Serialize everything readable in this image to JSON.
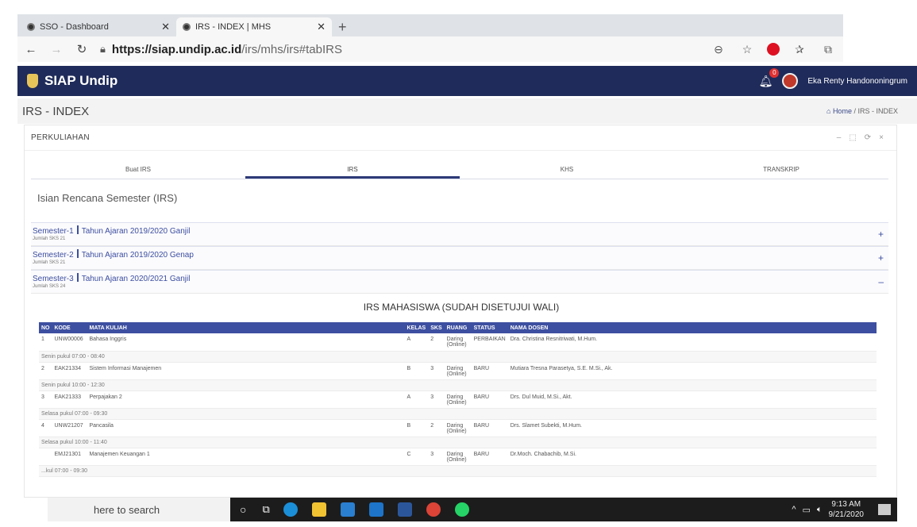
{
  "browser": {
    "tabs": [
      {
        "title": "SSO - Dashboard",
        "active": false
      },
      {
        "title": "IRS - INDEX | MHS",
        "active": true
      }
    ],
    "new_tab": "+",
    "url_host": "https://siap.undip.ac.id",
    "url_path": "/irs/mhs/irs#tabIRS"
  },
  "header": {
    "title": "SIAP Undip",
    "notification_count": "0",
    "user_name": "Eka Renty Handononingrum"
  },
  "page": {
    "title": "IRS - INDEX",
    "breadcrumb_home": "Home",
    "breadcrumb_current": "IRS - INDEX"
  },
  "panel": {
    "title": "PERKULIAHAN",
    "tools": [
      "–",
      "⬚",
      "⟳",
      "×"
    ],
    "tabs": [
      "Buat IRS",
      "IRS",
      "KHS",
      "TRANSKRIP"
    ],
    "section_title": "Isian Rencana Semester (IRS)"
  },
  "semesters": [
    {
      "label": "Semester-1",
      "period": "Tahun Ajaran 2019/2020 Ganjil",
      "sks": "Jumlah SKS 21",
      "toggle": "+"
    },
    {
      "label": "Semester-2",
      "period": "Tahun Ajaran 2019/2020 Genap",
      "sks": "Jumlah SKS 21",
      "toggle": "+"
    },
    {
      "label": "Semester-3",
      "period": "Tahun Ajaran 2020/2021 Ganjil",
      "sks": "Jumlah SKS 24",
      "toggle": "–"
    }
  ],
  "irs": {
    "title": "IRS MAHASISWA (SUDAH DISETUJUI WALI)",
    "columns": [
      "NO",
      "KODE",
      "MATA KULIAH",
      "KELAS",
      "SKS",
      "RUANG",
      "STATUS",
      "NAMA DOSEN"
    ],
    "rows": [
      {
        "no": "1",
        "kode": "UNW00006",
        "mk": "Bahasa Inggris",
        "kelas": "A",
        "sks": "2",
        "ruang": "Daring (Online)",
        "status": "PERBAIKAN",
        "dosen": "Dra. Christina Resnitriwati, M.Hum.",
        "jadwal": "Senin pukul 07:00 - 08:40"
      },
      {
        "no": "2",
        "kode": "EAK21334",
        "mk": "Sistem Informasi Manajemen",
        "kelas": "B",
        "sks": "3",
        "ruang": "Daring (Online)",
        "status": "BARU",
        "dosen": "Mutiara Tresna Parasetya, S.E. M.Si., Ak.",
        "jadwal": "Senin pukul 10:00 - 12:30"
      },
      {
        "no": "3",
        "kode": "EAK21333",
        "mk": "Perpajakan 2",
        "kelas": "A",
        "sks": "3",
        "ruang": "Daring (Online)",
        "status": "BARU",
        "dosen": "Drs. Dul Muid, M.Si., Akt.",
        "jadwal": "Selasa pukul 07:00 - 09:30"
      },
      {
        "no": "4",
        "kode": "UNW21207",
        "mk": "Pancasila",
        "kelas": "B",
        "sks": "2",
        "ruang": "Daring (Online)",
        "status": "BARU",
        "dosen": "Drs. Slamet Subekti, M.Hum.",
        "jadwal": "Selasa pukul 10:00 - 11:40"
      },
      {
        "no": "",
        "kode": "EMJ21301",
        "mk": "Manajemen Keuangan 1",
        "kelas": "C",
        "sks": "3",
        "ruang": "Daring (Online)",
        "status": "BARU",
        "dosen": "Dr.Moch. Chabachib, M.Si.",
        "jadwal": "...kul 07:00 - 09:30"
      }
    ]
  },
  "taskbar": {
    "search": "here to search",
    "time": "9:13 AM",
    "date": "9/21/2020"
  }
}
